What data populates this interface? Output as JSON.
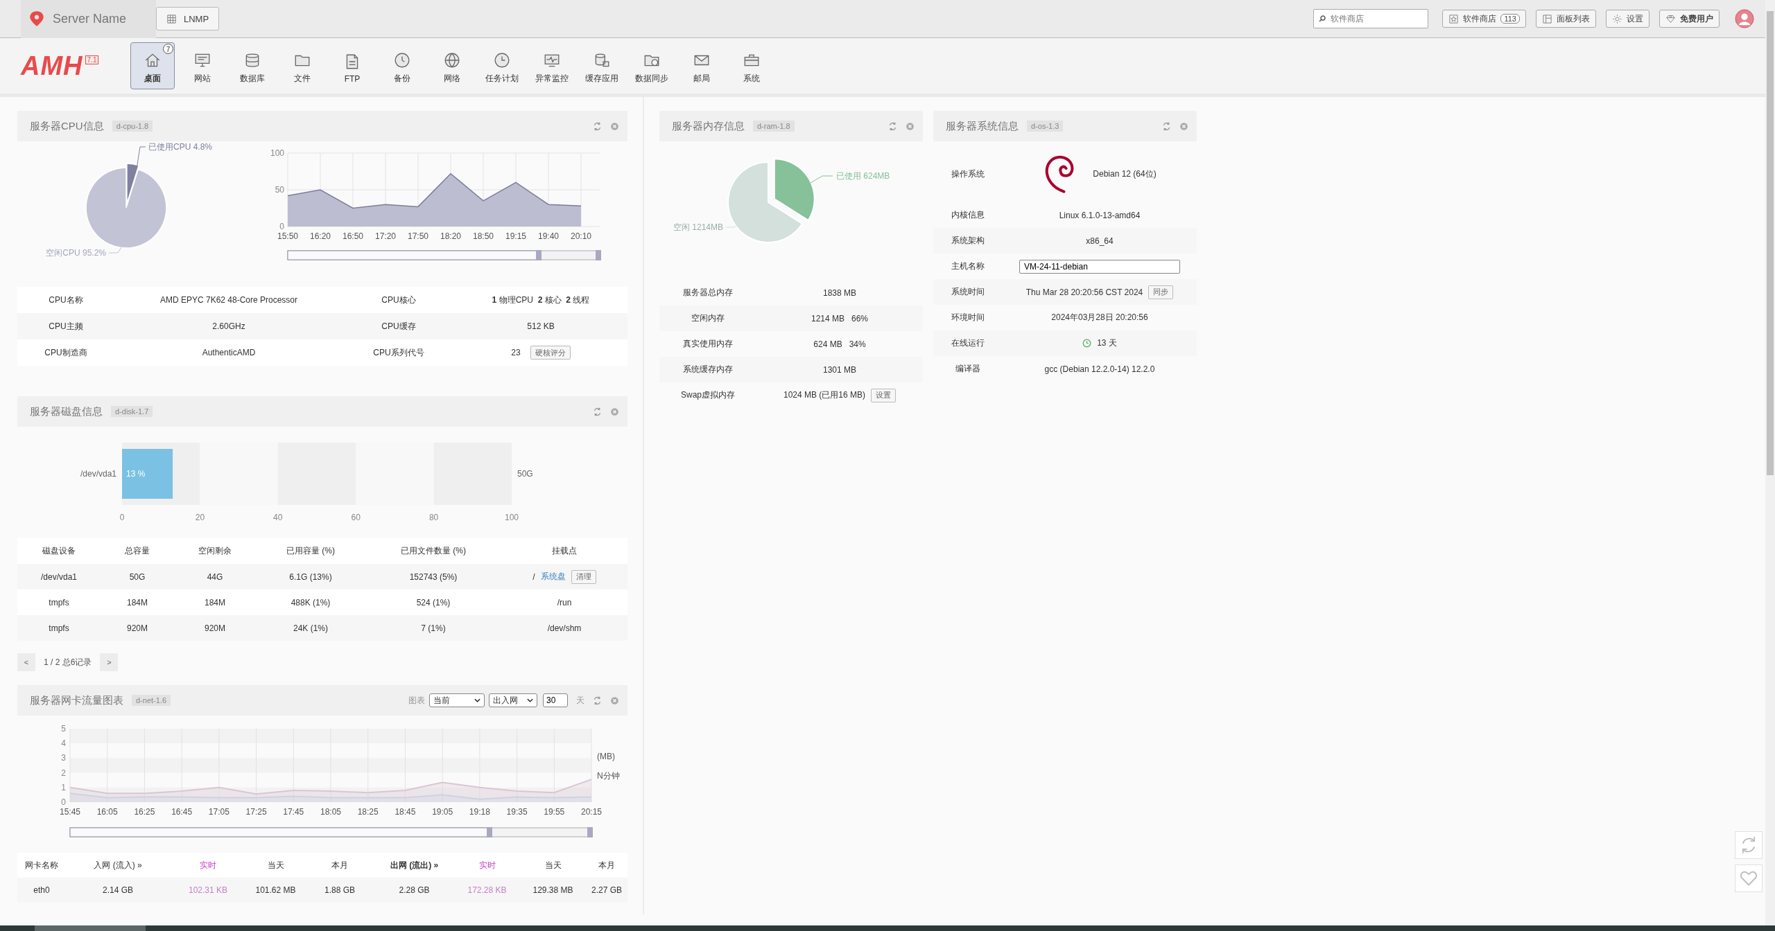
{
  "header": {
    "server_name": "Server Name",
    "stack_button": "LNMP",
    "search": {
      "placeholder": "软件商店"
    },
    "buttons": [
      {
        "label": "软件商店",
        "badge": "113"
      },
      {
        "label": "面板列表"
      },
      {
        "label": "设置"
      },
      {
        "label": "免费用户"
      }
    ]
  },
  "logo": {
    "text": "AMH",
    "version": "7.1"
  },
  "nav": [
    {
      "label": "桌面",
      "selected": true,
      "badge": "7"
    },
    {
      "label": "网站",
      "selected": false
    },
    {
      "label": "数据库",
      "selected": false
    },
    {
      "label": "文件",
      "selected": false
    },
    {
      "label": "FTP",
      "selected": false
    },
    {
      "label": "备份",
      "selected": false
    },
    {
      "label": "网络",
      "selected": false
    },
    {
      "label": "任务计划",
      "selected": false
    },
    {
      "label": "异常监控",
      "selected": false
    },
    {
      "label": "缓存应用",
      "selected": false
    },
    {
      "label": "数据同步",
      "selected": false
    },
    {
      "label": "邮局",
      "selected": false
    },
    {
      "label": "系统",
      "selected": false
    }
  ],
  "cpu_panel": {
    "title": "服务器CPU信息",
    "tag": "d-cpu-1.8",
    "pie": {
      "chart_data": {
        "type": "pie",
        "categories": [
          "已使用CPU 4.8%",
          "空闲CPU 95.2%"
        ],
        "values": [
          4.8,
          95.2
        ],
        "colors": [
          "#7f819f",
          "#c2c3d5"
        ]
      }
    },
    "line": {
      "chart_data": {
        "type": "area",
        "grid": true,
        "ylim": [
          0,
          100
        ],
        "yticks": [
          0,
          50,
          100
        ],
        "categories": [
          "15:50",
          "16:20",
          "16:50",
          "17:20",
          "17:50",
          "18:20",
          "18:50",
          "19:15",
          "19:40",
          "20:10"
        ],
        "series": [
          {
            "color": "#7b7d9e",
            "values": [
              42,
              50,
              25,
              30,
              27,
              72,
              35,
              60,
              30,
              28
            ]
          }
        ]
      }
    },
    "rows": [
      [
        {
          "label": "CPU名称",
          "value": "AMD EPYC 7K62 48-Core Processor"
        },
        {
          "label": "CPU核心",
          "value": "**1** 物理CPU  **2** 核心  **2** 线程"
        }
      ],
      [
        {
          "label": "CPU主频",
          "value": "2.60GHz"
        },
        {
          "label": "CPU缓存",
          "value": "512 KB"
        }
      ],
      [
        {
          "label": "CPU制造商",
          "value": "AuthenticAMD"
        },
        {
          "label": "CPU系列代号",
          "value": "23",
          "button": "硬核评分"
        }
      ]
    ]
  },
  "memory_panel": {
    "title": "服务器内存信息",
    "tag": "d-ram-1.8",
    "pie": {
      "chart_data": {
        "type": "pie",
        "categories": [
          "已使用 624MB",
          "空闲 1214MB"
        ],
        "values": [
          624,
          1214
        ],
        "colors": [
          "#86c19a",
          "#d3e0dc"
        ]
      }
    },
    "rows": [
      {
        "label": "服务器总内存",
        "value": "1838 MB"
      },
      {
        "label": "空闲内存",
        "value": "1214 MB   66%"
      },
      {
        "label": "真实使用内存",
        "value": "624 MB   34%"
      },
      {
        "label": "系统缓存内存",
        "value": "1301 MB"
      },
      {
        "label": "Swap虚拟内存",
        "value": "1024 MB (已用16 MB)",
        "button": "设置"
      }
    ]
  },
  "system_panel": {
    "title": "服务器系统信息",
    "tag": "d-os-1.3",
    "rows": [
      {
        "kind": "os",
        "label": "操作系统",
        "value": "Debian 12 (64位)"
      },
      {
        "kind": "text",
        "label": "内核信息",
        "value": "Linux 6.1.0-13-amd64"
      },
      {
        "kind": "text",
        "label": "系统架构",
        "value": "x86_64"
      },
      {
        "kind": "input",
        "label": "主机名称",
        "value": "VM-24-11-debian"
      },
      {
        "kind": "button",
        "label": "系统时间",
        "value": "Thu Mar 28 20:20:56 CST 2024",
        "button": "同步"
      },
      {
        "kind": "text",
        "label": "环境时间",
        "value": "2024年03月28日 20:20:56"
      },
      {
        "kind": "uptime",
        "label": "在线运行",
        "value": "13 天"
      },
      {
        "kind": "text",
        "label": "编译器",
        "value": "gcc (Debian 12.2.0-14) 12.2.0"
      }
    ]
  },
  "disk_panel": {
    "title": "服务器磁盘信息",
    "tag": "d-disk-1.7",
    "chart": {
      "chart_data": {
        "type": "bar",
        "orientation": "horizontal",
        "categories": [
          "/dev/vda1"
        ],
        "series": [
          {
            "color": "#7bc1e3",
            "values": [
              13
            ]
          }
        ],
        "xlim": [
          0,
          100
        ],
        "xticks": [
          0,
          20,
          40,
          60,
          80,
          100
        ],
        "value_labels": [
          "13 %"
        ],
        "annotations": [
          {
            "text": "50G"
          }
        ]
      }
    },
    "columns": [
      "磁盘设备",
      "总容量",
      "空闲剩余",
      "已用容量 (%)",
      "已用文件数量 (%)",
      "挂载点"
    ],
    "rows": [
      {
        "cells": [
          "/dev/vda1",
          "50G",
          "44G",
          "6.1G (13%)",
          "152743 (5%)"
        ],
        "mount": "/",
        "mount_link": "系统盘",
        "mount_button": "清理"
      },
      {
        "cells": [
          "tmpfs",
          "184M",
          "184M",
          "488K (1%)",
          "524 (1%)"
        ],
        "mount": "/run"
      },
      {
        "cells": [
          "tmpfs",
          "920M",
          "920M",
          "24K (1%)",
          "7 (1%)"
        ],
        "mount": "/dev/shm"
      }
    ],
    "pagination": {
      "prev": "<",
      "info": "1 / 2 总6记录",
      "next": ">"
    }
  },
  "net_panel": {
    "title": "服务器网卡流量图表",
    "tag": "d-net-1.6",
    "controls": {
      "label": "图表",
      "select_1": "当前",
      "select_2": "出入网",
      "days": "30",
      "unit": "天"
    },
    "chart": {
      "chart_data": {
        "type": "area",
        "grid": true,
        "ylim": [
          0,
          5
        ],
        "yticks": [
          0,
          1,
          2,
          3,
          4,
          5
        ],
        "ylabel": "(MB)",
        "annotations": [
          {
            "text": "N分钟"
          }
        ],
        "categories": [
          "15:45",
          "16:05",
          "16:25",
          "16:45",
          "17:05",
          "17:25",
          "17:45",
          "18:05",
          "18:25",
          "18:45",
          "19:05",
          "19:18",
          "19:35",
          "19:55",
          "20:15"
        ],
        "series": [
          {
            "color": "#d9c6d3",
            "values": [
              1.0,
              0.6,
              0.6,
              0.75,
              1.0,
              0.55,
              0.8,
              0.75,
              0.65,
              0.8,
              1.35,
              1.0,
              0.75,
              0.65,
              1.55
            ]
          },
          {
            "color": "#cdd2e3",
            "values": [
              0.6,
              0.3,
              0.35,
              0.35,
              0.3,
              0.3,
              0.4,
              0.3,
              0.3,
              0.3,
              0.5,
              0.2,
              0.35,
              0.3,
              0.35
            ]
          }
        ]
      }
    },
    "columns": [
      {
        "text": "网卡名称",
        "kind": "plain"
      },
      {
        "text": "入网 (流入) »",
        "kind": "plain"
      },
      {
        "text": "实时",
        "kind": "realtime"
      },
      {
        "text": "当天",
        "kind": "plain"
      },
      {
        "text": "本月",
        "kind": "plain"
      },
      {
        "text": "出网 (流出) »",
        "kind": "bold"
      },
      {
        "text": "实时",
        "kind": "realtime"
      },
      {
        "text": "当天",
        "kind": "plain"
      },
      {
        "text": "本月",
        "kind": "plain"
      }
    ],
    "rows": [
      [
        "eth0",
        "2.14 GB",
        "102.31 KB",
        "101.62 MB",
        "1.88 GB",
        "2.28 GB",
        "172.28 KB",
        "129.38 MB",
        "2.27 GB"
      ]
    ]
  }
}
